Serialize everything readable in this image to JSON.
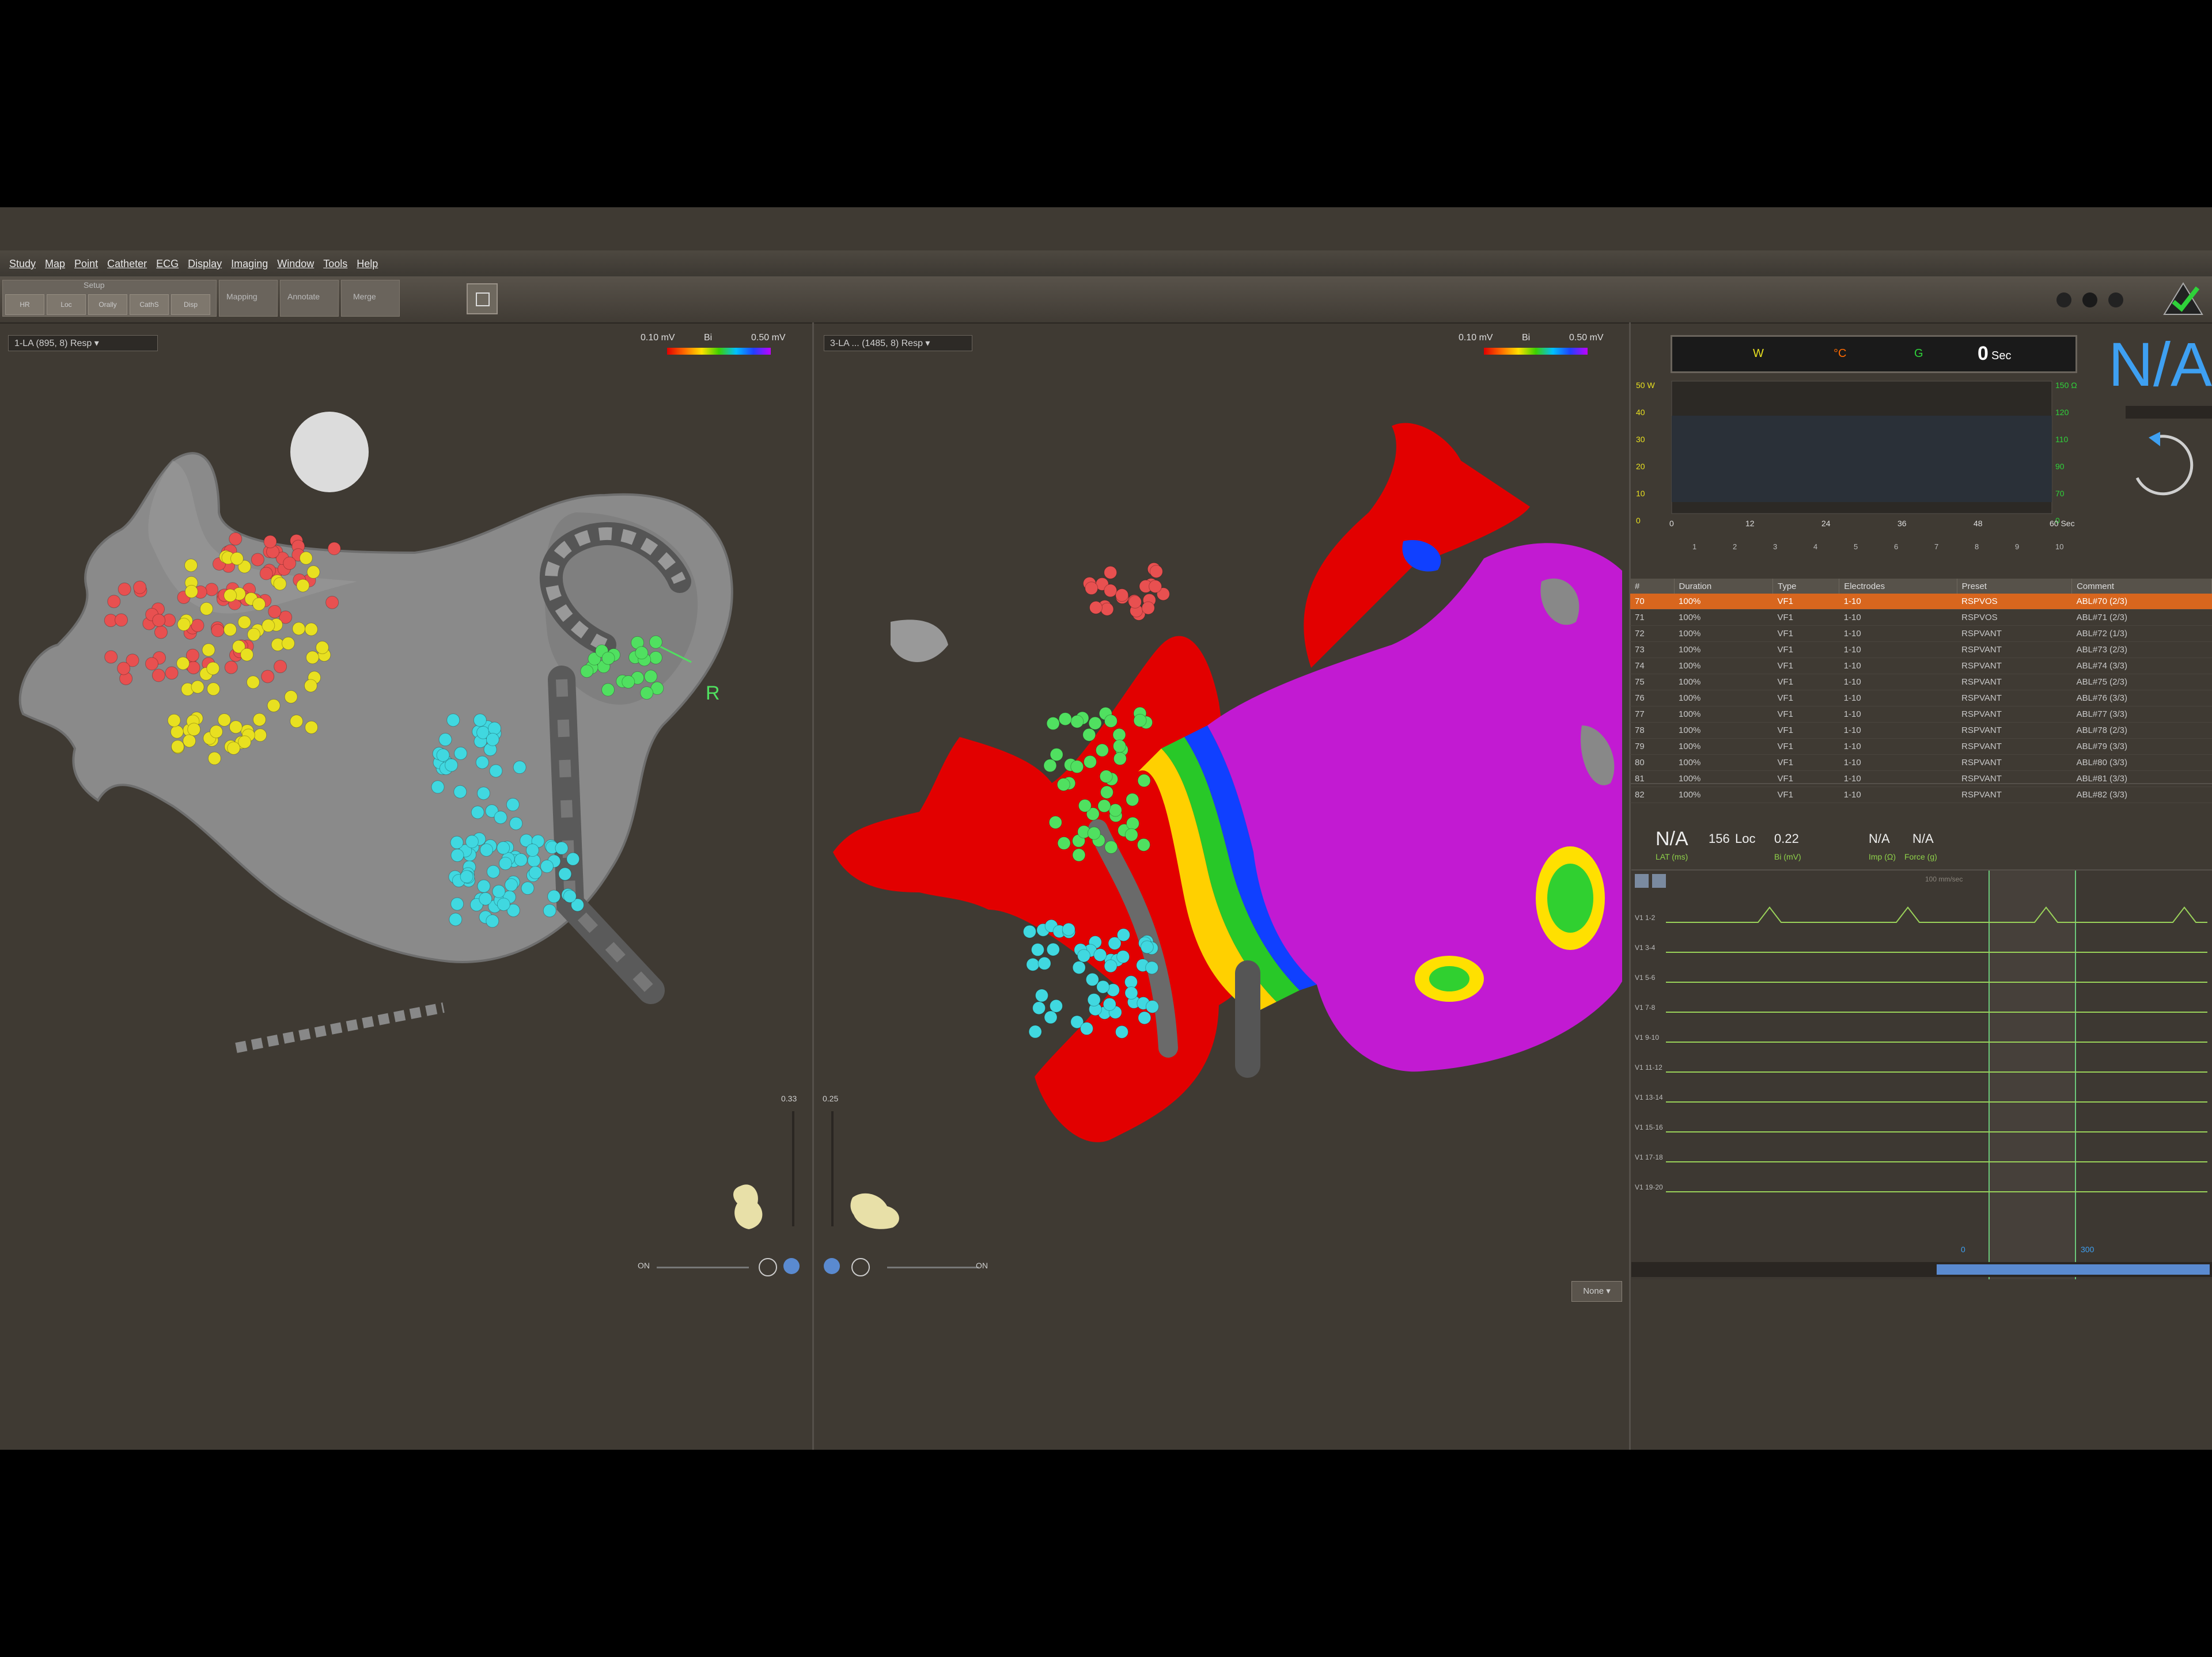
{
  "menu": [
    "Study",
    "Map",
    "Point",
    "Catheter",
    "ECG",
    "Display",
    "Imaging",
    "Window",
    "Tools",
    "Help"
  ],
  "toolbar": {
    "group_label": "Setup",
    "small_buttons": [
      "HR",
      "Loc",
      "Orally",
      "CathS",
      "Disp"
    ],
    "big_buttons": [
      "Mapping",
      "Annotate",
      "Merge"
    ]
  },
  "left_panel": {
    "map_select": "1-LA (895, 8) Resp",
    "scale_min": "0.10 mV",
    "scale_mode": "Bi",
    "scale_max": "0.50 mV",
    "marker_label": "R",
    "slider_value": "0.33",
    "toggle_label": "ON"
  },
  "right_map_panel": {
    "map_select": "3-LA ... (1485, 8) Resp",
    "scale_min": "0.10 mV",
    "scale_mode": "Bi",
    "scale_max": "0.50 mV",
    "slider_value": "0.25",
    "toggle_label": "ON",
    "none_button": "None"
  },
  "ablation_monitor": {
    "header_w": "W",
    "header_c": "°C",
    "header_g": "G",
    "timer": "0",
    "timer_unit": "Sec",
    "big_status": "N/A",
    "left_axis": [
      "50 W",
      "40",
      "30",
      "20",
      "10",
      "0"
    ],
    "right_axis": [
      "150 Ω",
      "120",
      "110",
      "90",
      "70",
      "0"
    ],
    "x_ticks": [
      "0",
      "12",
      "24",
      "36",
      "48",
      "60 Sec"
    ],
    "ruler": [
      "1",
      "2",
      "3",
      "4",
      "5",
      "6",
      "7",
      "8",
      "9",
      "10"
    ]
  },
  "ablation_table": {
    "columns": [
      "#",
      "Duration",
      "Type",
      "Electrodes",
      "Preset",
      "Comment"
    ],
    "rows": [
      [
        "70",
        "100%",
        "VF1",
        "1-10",
        "RSPVOS",
        "ABL#70 (2/3)"
      ],
      [
        "71",
        "100%",
        "VF1",
        "1-10",
        "RSPVOS",
        "ABL#71 (2/3)"
      ],
      [
        "72",
        "100%",
        "VF1",
        "1-10",
        "RSPVANT",
        "ABL#72 (1/3)"
      ],
      [
        "73",
        "100%",
        "VF1",
        "1-10",
        "RSPVANT",
        "ABL#73 (2/3)"
      ],
      [
        "74",
        "100%",
        "VF1",
        "1-10",
        "RSPVANT",
        "ABL#74 (3/3)"
      ],
      [
        "75",
        "100%",
        "VF1",
        "1-10",
        "RSPVANT",
        "ABL#75 (2/3)"
      ],
      [
        "76",
        "100%",
        "VF1",
        "1-10",
        "RSPVANT",
        "ABL#76 (3/3)"
      ],
      [
        "77",
        "100%",
        "VF1",
        "1-10",
        "RSPVANT",
        "ABL#77 (3/3)"
      ],
      [
        "78",
        "100%",
        "VF1",
        "1-10",
        "RSPVANT",
        "ABL#78 (2/3)"
      ],
      [
        "79",
        "100%",
        "VF1",
        "1-10",
        "RSPVANT",
        "ABL#79 (3/3)"
      ],
      [
        "80",
        "100%",
        "VF1",
        "1-10",
        "RSPVANT",
        "ABL#80 (3/3)"
      ],
      [
        "81",
        "100%",
        "VF1",
        "1-10",
        "RSPVANT",
        "ABL#81 (3/3)"
      ],
      [
        "82",
        "100%",
        "VF1",
        "1-10",
        "RSPVANT",
        "ABL#82 (3/3)"
      ]
    ]
  },
  "point_status": {
    "value1": "N/A",
    "value1_sub": "LAT (ms)",
    "value2": "156",
    "value2_sub": "Loc",
    "value3": "0.22",
    "value3_sub": "Bi (mV)",
    "value4": "N/A",
    "value4_sub": "Imp (Ω)",
    "value5": "N/A",
    "value5_sub": "Force (g)"
  },
  "ecg": {
    "speed": "100 mm/sec",
    "channels": [
      "V1 1-2",
      "V1 3-4",
      "V1 5-6",
      "V1 7-8",
      "V1 9-10",
      "V1 11-12",
      "V1 13-14",
      "V1 15-16",
      "V1 17-18",
      "V1 19-20"
    ],
    "marker_left": "0",
    "marker_right": "300"
  },
  "colors": {
    "lat_red": "#e20000",
    "lat_magenta": "#c21ad2",
    "dot_red": "#e85050",
    "dot_yellow": "#e8e020",
    "dot_cyan": "#40d8e0",
    "dot_green": "#50e060",
    "ecg_trace": "#9ad25a",
    "selection": "#d8661e"
  }
}
